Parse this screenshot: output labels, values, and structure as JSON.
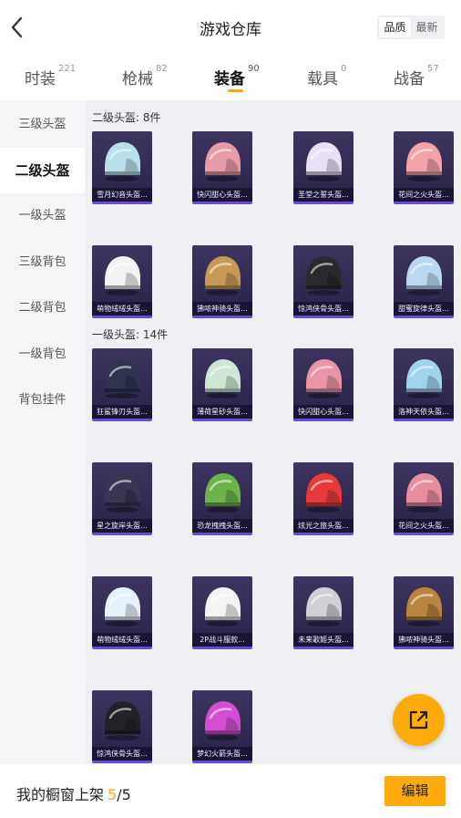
{
  "header": {
    "title": "游戏仓库",
    "sort_options": [
      "品质",
      "最新"
    ]
  },
  "tabs": [
    {
      "label": "时装",
      "count": "221"
    },
    {
      "label": "枪械",
      "count": "82"
    },
    {
      "label": "装备",
      "count": "90"
    },
    {
      "label": "载具",
      "count": "0"
    },
    {
      "label": "战备",
      "count": "57"
    }
  ],
  "sidebar": {
    "items": [
      "三级头盔",
      "二级头盔",
      "一级头盔",
      "三级背包",
      "二级背包",
      "一级背包",
      "背包挂件"
    ]
  },
  "sections": [
    {
      "title": "二级头盔: 8件",
      "items": [
        {
          "name": "雪月幻音头盔...",
          "color": "#b9e0ea"
        },
        {
          "name": "快闪甜心头盔...",
          "color": "#e89aa8"
        },
        {
          "name": "圣堂之誓头盔...",
          "color": "#e8e0f4"
        },
        {
          "name": "花间之火头盔...",
          "color": "#f1a3a8"
        },
        {
          "name": "萌物绒绒头盔...",
          "color": "#f2f2f4"
        },
        {
          "name": "狒哝神骑头盔...",
          "color": "#c69a55"
        },
        {
          "name": "惊鸿侠骨头盔...",
          "color": "#2a2a2e"
        },
        {
          "name": "甜蜜旋律头盔...",
          "color": "#bcd8f0"
        }
      ]
    },
    {
      "title": "一级头盔: 14件",
      "items": [
        {
          "name": "狂鲨锋刃头盔...",
          "color": "#2f3550"
        },
        {
          "name": "薄荷星砂头盔...",
          "color": "#cfe6d4"
        },
        {
          "name": "快闪甜心头盔...",
          "color": "#e995a6"
        },
        {
          "name": "洛神天依头盔...",
          "color": "#9fd4ef"
        },
        {
          "name": "星之旋岸头盔...",
          "color": "#3a3550"
        },
        {
          "name": "恐龙拽拽头盔...",
          "color": "#6bb34a"
        },
        {
          "name": "炫光之旅头盔...",
          "color": "#e63a3a"
        },
        {
          "name": "花间之火头盔...",
          "color": "#e68da0"
        },
        {
          "name": "萌物绒绒头盔...",
          "color": "#e6f0f8"
        },
        {
          "name": "2P战斗服款...",
          "color": "#f3f3f3"
        },
        {
          "name": "未来歌姬头盔...",
          "color": "#cfcfd6"
        },
        {
          "name": "狒哝神骑头盔...",
          "color": "#b88540"
        },
        {
          "name": "惊鸿侠骨头盔...",
          "color": "#222226"
        },
        {
          "name": "梦幻火箭头盔...",
          "color": "#d14fd0"
        }
      ]
    }
  ],
  "bottom": {
    "label": "我的橱窗上架",
    "count": "5",
    "total": "5",
    "edit_label": "编辑"
  },
  "colors": {
    "accent": "#ffab0c",
    "card_bg": "#2f2850",
    "card_border": "#6c4bd8"
  }
}
